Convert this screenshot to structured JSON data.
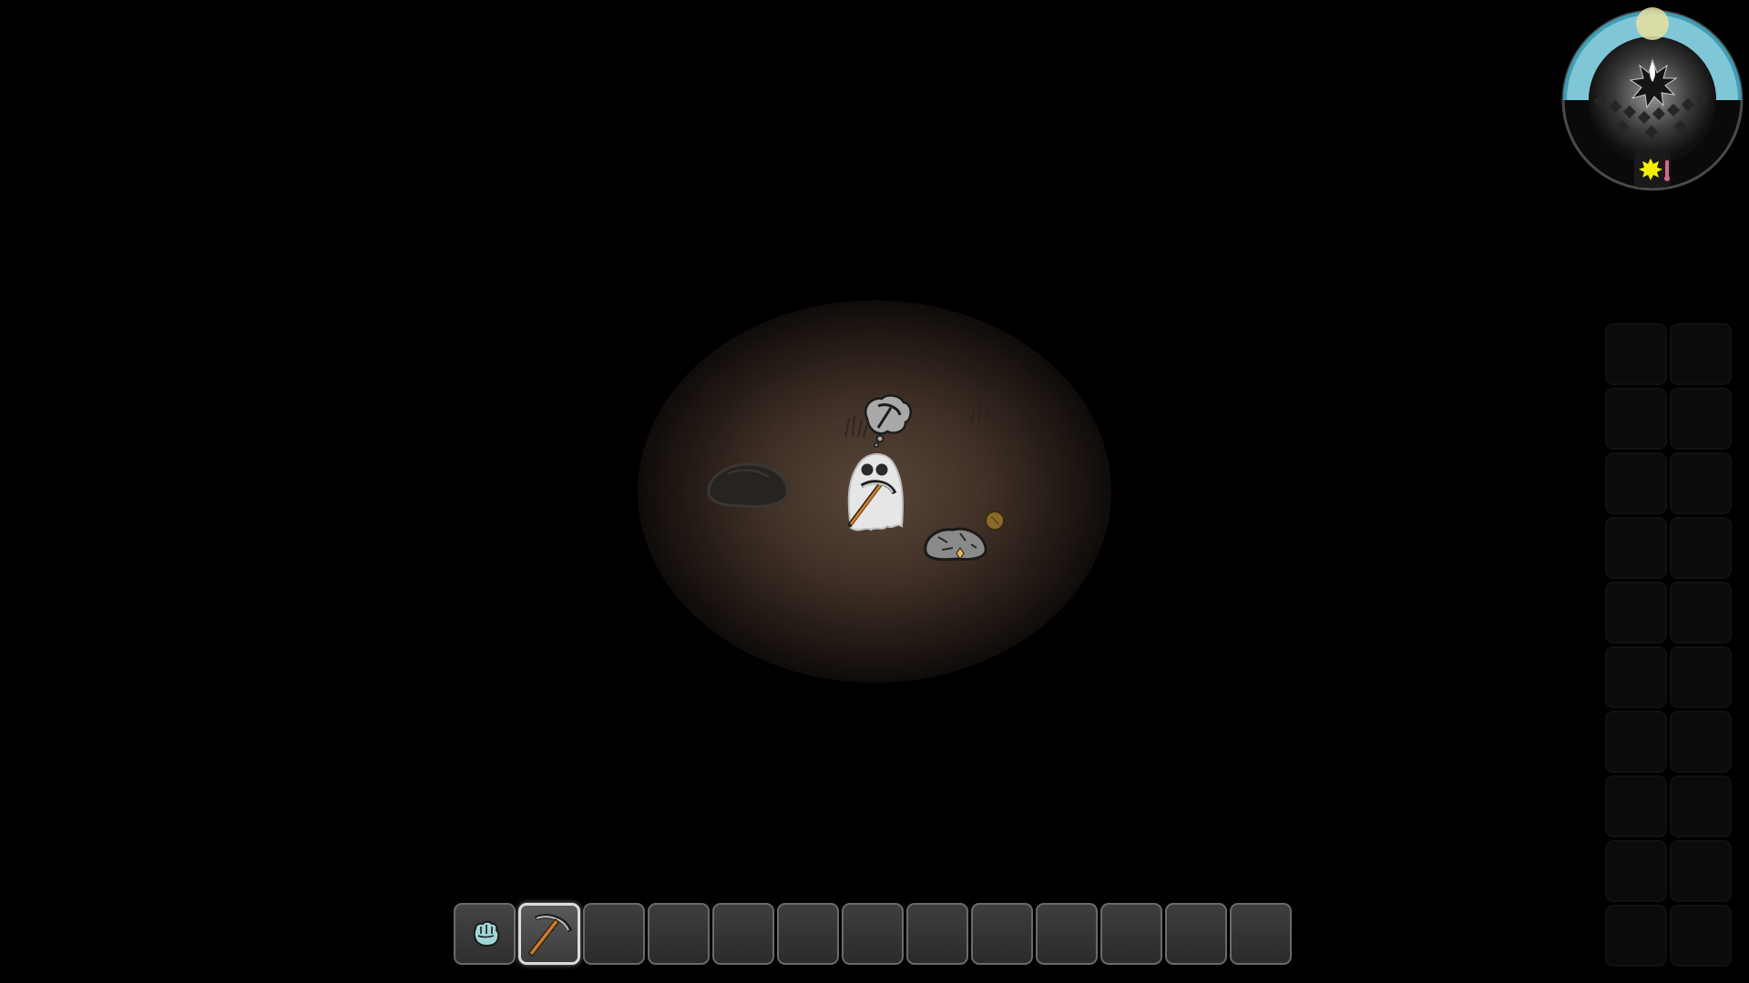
{
  "game": {
    "title": "",
    "theme_colors": {
      "background": "#000000",
      "ground_lit": "#5a4638",
      "hotbar_border": "#6a6a6a",
      "selected_border": "#dcdcdc",
      "sky": "#7fc6d6",
      "sun": "#f4f000"
    }
  },
  "world": {
    "entities": [
      {
        "name": "player-ghost",
        "icon": "ghost-character-icon"
      },
      {
        "name": "thought-bubble",
        "icon": "pickaxe-thought-icon"
      },
      {
        "name": "boulder",
        "icon": "boulder-icon"
      },
      {
        "name": "ore-rock",
        "icon": "ore-rock-icon"
      },
      {
        "name": "seed",
        "icon": "seed-icon"
      },
      {
        "name": "grass-tuft",
        "icon": "grass-icon"
      }
    ]
  },
  "clock": {
    "icons": [
      "sun-icon",
      "moon-icon",
      "spiky-core-icon",
      "thermometer-icon"
    ],
    "day_fraction": 0.5
  },
  "hotbar": {
    "slots": [
      {
        "icon": "fist-icon",
        "label": ""
      },
      {
        "icon": "pickaxe-icon",
        "label": "",
        "selected": true
      },
      {
        "icon": "",
        "label": ""
      },
      {
        "icon": "",
        "label": ""
      },
      {
        "icon": "",
        "label": ""
      },
      {
        "icon": "",
        "label": ""
      },
      {
        "icon": "",
        "label": ""
      },
      {
        "icon": "",
        "label": ""
      },
      {
        "icon": "",
        "label": ""
      },
      {
        "icon": "",
        "label": ""
      },
      {
        "icon": "",
        "label": ""
      },
      {
        "icon": "",
        "label": ""
      },
      {
        "icon": "",
        "label": ""
      }
    ]
  },
  "inventory": {
    "rows": 10,
    "columns": 2
  }
}
